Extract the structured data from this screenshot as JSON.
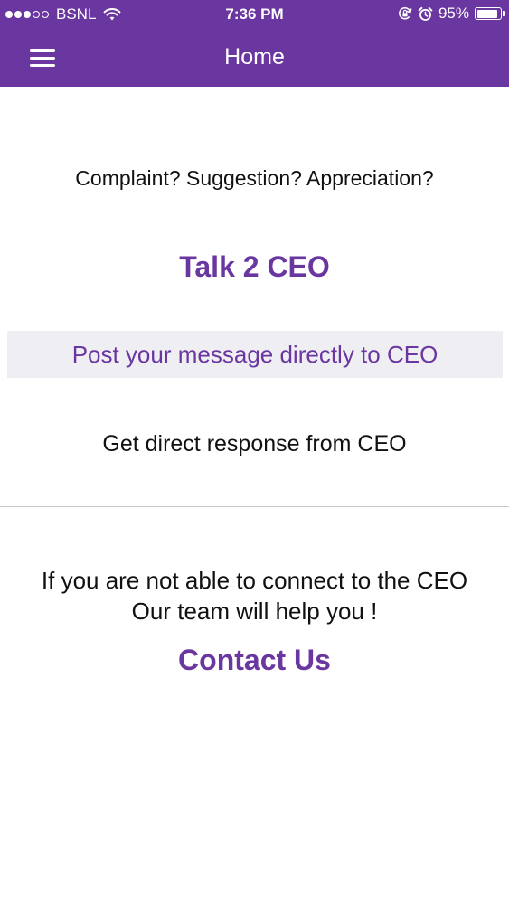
{
  "status_bar": {
    "carrier": "BSNL",
    "time": "7:36 PM",
    "battery_percent_label": "95%",
    "battery_level": 0.95,
    "signal_filled": 3,
    "signal_total": 5,
    "icons": [
      "wifi-icon",
      "orientation-lock-icon",
      "alarm-icon",
      "battery-icon"
    ]
  },
  "nav": {
    "title": "Home",
    "menu_icon": "hamburger-menu-icon"
  },
  "main": {
    "tagline": "Complaint? Suggestion? Appreciation?",
    "talk_link": "Talk 2 CEO",
    "post_strip": "Post your message directly to CEO",
    "response_text": "Get direct response from CEO",
    "help_line_1": "If you are not able to connect to the CEO",
    "help_line_2": "Our team will help you !",
    "contact_link": "Contact Us"
  },
  "colors": {
    "brand_purple": "#6a36a0",
    "strip_background": "#efeef3",
    "divider": "#c9c9c9"
  }
}
